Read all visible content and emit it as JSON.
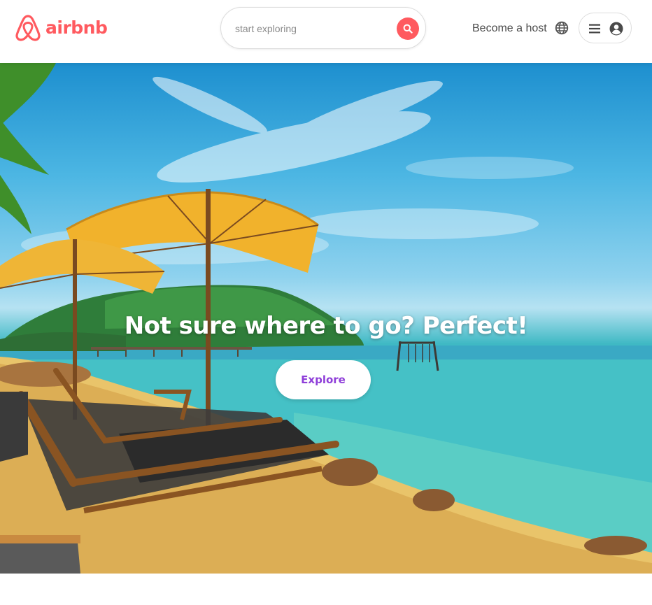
{
  "brand": {
    "name": "airbnb",
    "color": "#ff5a5f",
    "logo_icon": "airbnb-belo-icon"
  },
  "search": {
    "placeholder": "start exploring",
    "icon": "search-icon"
  },
  "header": {
    "host_label": "Become a host",
    "globe_icon": "globe-icon",
    "menu_icon": "hamburger-menu-icon",
    "account_icon": "account-circle-icon"
  },
  "hero": {
    "title": "Not sure where to go? Perfect!",
    "button_label": "Explore",
    "button_color": "#8f3fd9"
  }
}
